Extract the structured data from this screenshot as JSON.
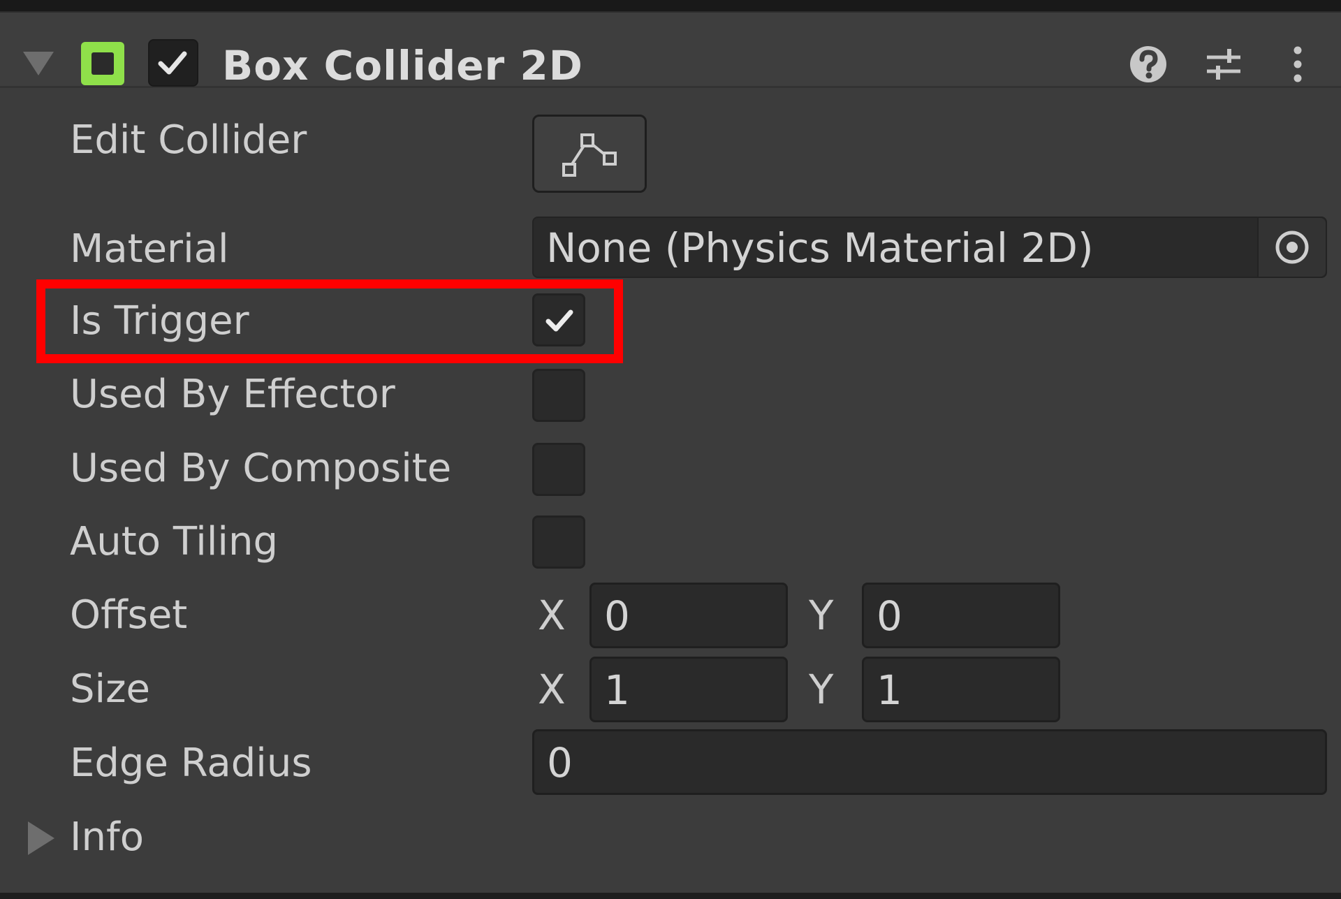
{
  "component": {
    "title": "Box Collider 2D",
    "enabled": true,
    "icon": "box-collider-2d-icon",
    "icon_color": "#8fe04a",
    "header_icons": [
      "help-icon",
      "presets-icon",
      "more-options-icon"
    ]
  },
  "edit_collider": {
    "label": "Edit Collider",
    "icon": "edit-collider-icon"
  },
  "material": {
    "label": "Material",
    "value": "None (Physics Material 2D)",
    "icon": "object-picker-icon"
  },
  "is_trigger": {
    "label": "Is Trigger",
    "checked": true
  },
  "used_by_effector": {
    "label": "Used By Effector",
    "checked": false
  },
  "used_by_composite": {
    "label": "Used By Composite",
    "checked": false
  },
  "auto_tiling": {
    "label": "Auto Tiling",
    "checked": false
  },
  "offset": {
    "label": "Offset",
    "x_label": "X",
    "x": "0",
    "y_label": "Y",
    "y": "0"
  },
  "size": {
    "label": "Size",
    "x_label": "X",
    "x": "1",
    "y_label": "Y",
    "y": "1"
  },
  "edge_radius": {
    "label": "Edge Radius",
    "value": "0"
  },
  "info": {
    "label": "Info"
  },
  "highlight_color": "#ff0000"
}
